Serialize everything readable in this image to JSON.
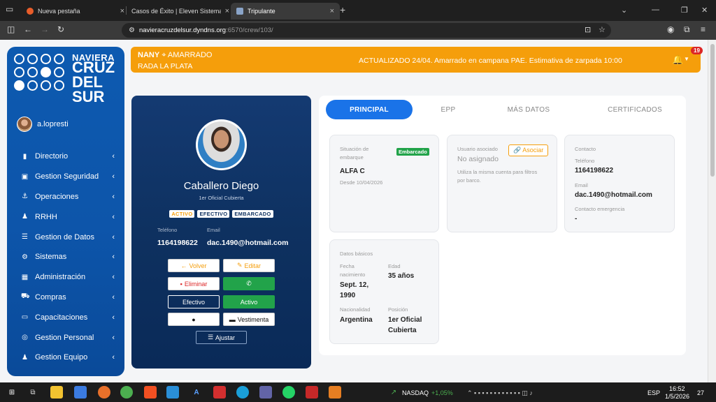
{
  "browser": {
    "tabs": [
      {
        "title": "Nueva pestaña"
      },
      {
        "title": "Casos de Éxito | Eleven Sistemas"
      },
      {
        "title": "Tripulante"
      }
    ],
    "url_host": "navieracruzdelsur.dyndns.org",
    "url_path": ":6570/crew/103/"
  },
  "brand": {
    "line1": "NAVIERA",
    "line2": "CRUZ",
    "line3": "DEL",
    "line4": "SUR"
  },
  "user": {
    "name": "a.lopresti"
  },
  "nav": [
    {
      "label": "Directorio",
      "icon": "briefcase-icon"
    },
    {
      "label": "Gestion Seguridad",
      "icon": "clipboard-check-icon"
    },
    {
      "label": "Operaciones",
      "icon": "anchor-icon"
    },
    {
      "label": "RRHH",
      "icon": "users-icon"
    },
    {
      "label": "Gestion de Datos",
      "icon": "database-icon"
    },
    {
      "label": "Sistemas",
      "icon": "cogs-icon"
    },
    {
      "label": "Administración",
      "icon": "building-icon"
    },
    {
      "label": "Compras",
      "icon": "cart-icon"
    },
    {
      "label": "Capacitaciones",
      "icon": "chalkboard-icon"
    },
    {
      "label": "Gestion Personal",
      "icon": "target-icon"
    },
    {
      "label": "Gestion Equipo",
      "icon": "team-icon"
    }
  ],
  "banner": {
    "vessel": "NANY",
    "status": "AMARRADO",
    "location": "RADA LA PLATA",
    "message": "ACTUALIZADO 24/04. Amarrado en campana PAE. Estimativa de zarpada 10:00",
    "notifications": "19"
  },
  "profile": {
    "name": "Caballero Diego",
    "role": "1er Oficial Cubierta",
    "tags": [
      "ACTIVO",
      "EFECTIVO",
      "EMBARCADO"
    ],
    "phone_label": "Teléfono",
    "phone": "1164198622",
    "email_label": "Email",
    "email": "dac.1490@hotmail.com",
    "buttons": {
      "back": "Volver",
      "edit": "Editar",
      "delete": "Eliminar",
      "type": "Efectivo",
      "status": "Activo",
      "clothing": "Vestimenta",
      "adjust": "Ajustar"
    }
  },
  "tabs": [
    {
      "label": "PRINCIPAL"
    },
    {
      "label": "EPP"
    },
    {
      "label": "MÁS DATOS"
    },
    {
      "label": "CERTIFICADOS"
    }
  ],
  "situacion": {
    "label": "Situación de embarque",
    "badge": "Embarcado",
    "vessel": "ALFA C",
    "since": "Desde 10/04/2026"
  },
  "usuario": {
    "label": "Usuario asociado",
    "value": "No asignado",
    "button": "Asociar",
    "hint": "Utiliza la misma cuenta para filtros por barco."
  },
  "contacto": {
    "label": "Contacto",
    "phone_label": "Teléfono",
    "phone": "1164198622",
    "email_label": "Email",
    "email": "dac.1490@hotmail.com",
    "emergency_label": "Contacto emergencia",
    "emergency": "-"
  },
  "basicos": {
    "label": "Datos básicos",
    "birth_label": "Fecha nacimiento",
    "birth": "Sept. 12, 1990",
    "age_label": "Edad",
    "age": "35 años",
    "nationality_label": "Nacionalidad",
    "nationality": "Argentina",
    "position_label": "Posición",
    "position": "1er Oficial Cubierta"
  },
  "taskbar": {
    "ticker": "NASDAQ",
    "change": "+1,05%",
    "lang": "ESP",
    "time": "16:52",
    "date": "1/5/2026",
    "badge": "27"
  }
}
